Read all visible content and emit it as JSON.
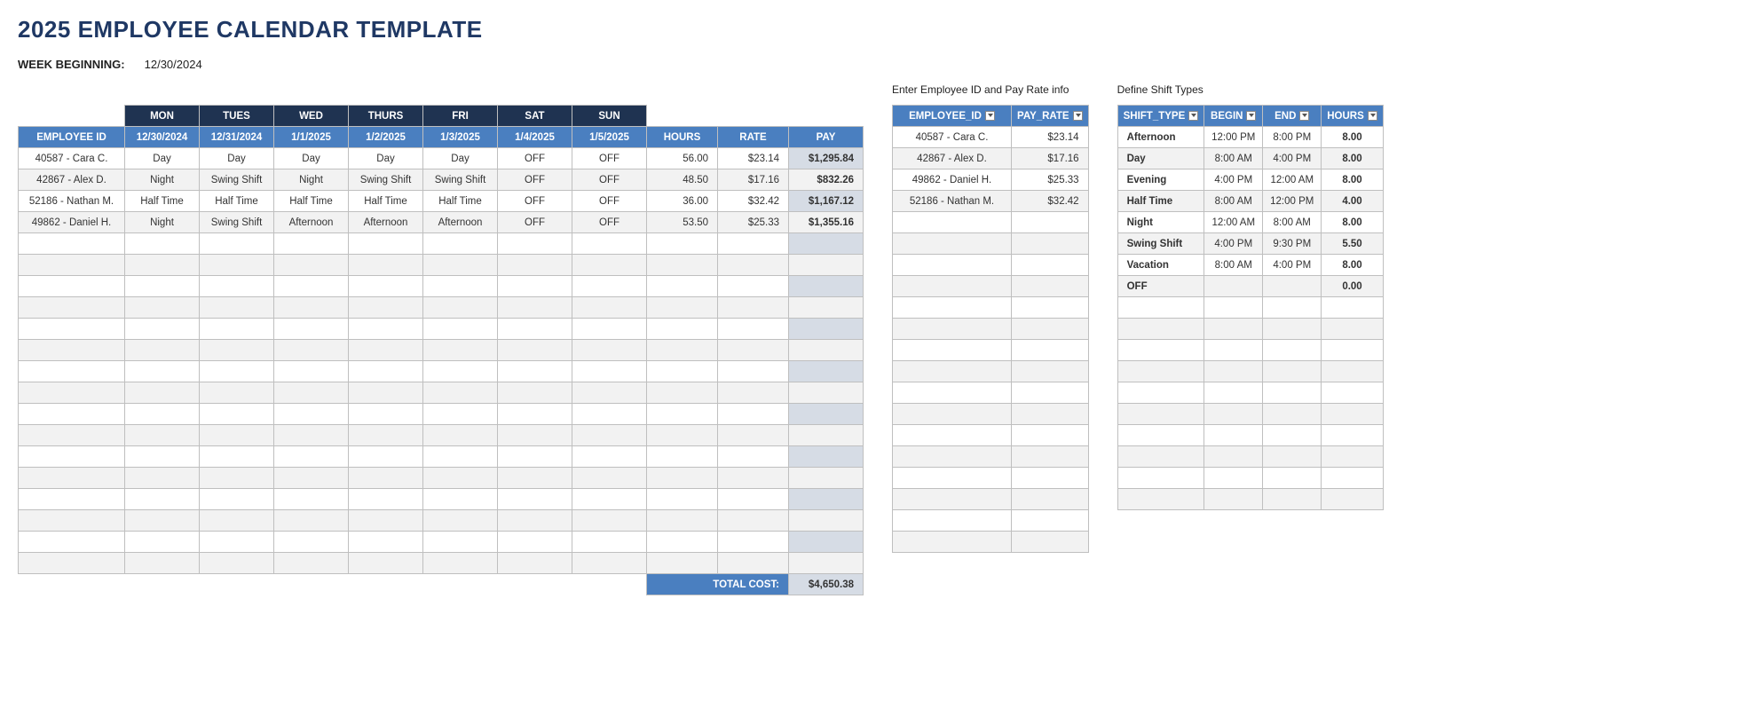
{
  "title": "2025 EMPLOYEE CALENDAR TEMPLATE",
  "week": {
    "label": "WEEK BEGINNING:",
    "date": "12/30/2024"
  },
  "main": {
    "dayNames": [
      "MON",
      "TUES",
      "WED",
      "THURS",
      "FRI",
      "SAT",
      "SUN"
    ],
    "headers": [
      "EMPLOYEE ID",
      "12/30/2024",
      "12/31/2024",
      "1/1/2025",
      "1/2/2025",
      "1/3/2025",
      "1/4/2025",
      "1/5/2025",
      "HOURS",
      "RATE",
      "PAY"
    ],
    "rows": [
      {
        "emp": "40587 - Cara C.",
        "d": [
          "Day",
          "Day",
          "Day",
          "Day",
          "Day",
          "OFF",
          "OFF"
        ],
        "hours": "56.00",
        "rate": "$23.14",
        "pay": "$1,295.84"
      },
      {
        "emp": "42867 - Alex D.",
        "d": [
          "Night",
          "Swing Shift",
          "Night",
          "Swing Shift",
          "Swing Shift",
          "OFF",
          "OFF"
        ],
        "hours": "48.50",
        "rate": "$17.16",
        "pay": "$832.26"
      },
      {
        "emp": "52186 - Nathan M.",
        "d": [
          "Half Time",
          "Half Time",
          "Half Time",
          "Half Time",
          "Half Time",
          "OFF",
          "OFF"
        ],
        "hours": "36.00",
        "rate": "$32.42",
        "pay": "$1,167.12"
      },
      {
        "emp": "49862 - Daniel H.",
        "d": [
          "Night",
          "Swing Shift",
          "Afternoon",
          "Afternoon",
          "Afternoon",
          "OFF",
          "OFF"
        ],
        "hours": "53.50",
        "rate": "$25.33",
        "pay": "$1,355.16"
      }
    ],
    "emptyRows": 16,
    "total": {
      "label": "TOTAL COST:",
      "value": "$4,650.38"
    }
  },
  "side1": {
    "caption": "Enter Employee ID and Pay Rate info",
    "headers": [
      "EMPLOYEE_ID",
      "PAY_RATE"
    ],
    "rows": [
      {
        "emp": "40587 - Cara C.",
        "rate": "$23.14"
      },
      {
        "emp": "42867 - Alex D.",
        "rate": "$17.16"
      },
      {
        "emp": "49862 - Daniel H.",
        "rate": "$25.33"
      },
      {
        "emp": "52186 - Nathan M.",
        "rate": "$32.42"
      }
    ],
    "emptyRows": 16
  },
  "side2": {
    "caption": "Define Shift Types",
    "headers": [
      "SHIFT_TYPE",
      "BEGIN",
      "END",
      "HOURS"
    ],
    "rows": [
      {
        "type": "Afternoon",
        "begin": "12:00 PM",
        "end": "8:00 PM",
        "hours": "8.00"
      },
      {
        "type": "Day",
        "begin": "8:00 AM",
        "end": "4:00 PM",
        "hours": "8.00"
      },
      {
        "type": "Evening",
        "begin": "4:00 PM",
        "end": "12:00 AM",
        "hours": "8.00"
      },
      {
        "type": "Half Time",
        "begin": "8:00 AM",
        "end": "12:00 PM",
        "hours": "4.00"
      },
      {
        "type": "Night",
        "begin": "12:00 AM",
        "end": "8:00 AM",
        "hours": "8.00"
      },
      {
        "type": "Swing Shift",
        "begin": "4:00 PM",
        "end": "9:30 PM",
        "hours": "5.50"
      },
      {
        "type": "Vacation",
        "begin": "8:00 AM",
        "end": "4:00 PM",
        "hours": "8.00"
      },
      {
        "type": "OFF",
        "begin": "",
        "end": "",
        "hours": "0.00"
      }
    ],
    "emptyRows": 10
  }
}
